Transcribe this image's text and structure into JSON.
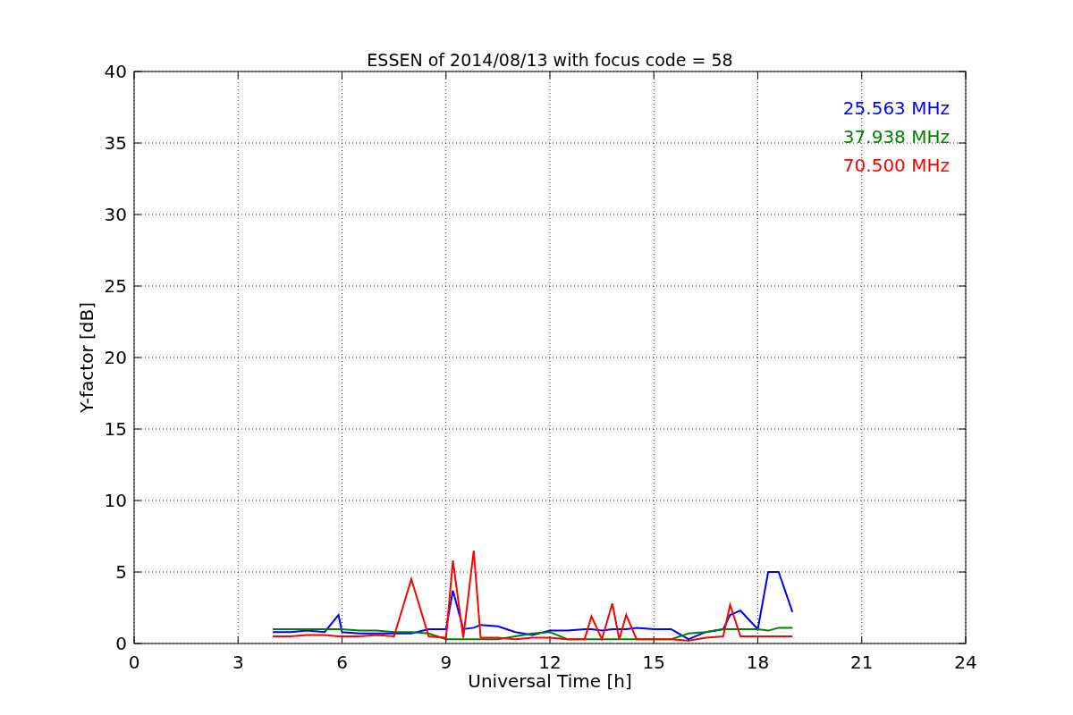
{
  "chart_data": {
    "type": "line",
    "title": "ESSEN of 2014/08/13 with focus code = 58",
    "xlabel": "Universal Time [h]",
    "ylabel": "Y-factor [dB]",
    "x": [
      4,
      4.5,
      5,
      5.5,
      5.9,
      6,
      6.5,
      7,
      7.5,
      8,
      8.5,
      9,
      9.2,
      9.5,
      9.8,
      10,
      10.5,
      11,
      11.5,
      12,
      12.5,
      13,
      13.2,
      13.5,
      13.8,
      14,
      14.2,
      14.5,
      15,
      15.5,
      16,
      16.5,
      17,
      17.2,
      17.5,
      18,
      18.3,
      18.6,
      19
    ],
    "grid": true,
    "xlim": [
      0,
      24
    ],
    "ylim": [
      0,
      40
    ],
    "xticks": [
      0,
      3,
      6,
      9,
      12,
      15,
      18,
      21,
      24
    ],
    "yticks": [
      0,
      5,
      10,
      15,
      20,
      25,
      30,
      35,
      40
    ],
    "series": [
      {
        "name": "25.563 MHz",
        "color": "#0000ff",
        "values": [
          0.8,
          0.8,
          0.9,
          0.8,
          2.0,
          0.8,
          0.7,
          0.7,
          0.7,
          0.7,
          1.0,
          1.0,
          3.7,
          1.0,
          1.1,
          1.3,
          1.2,
          0.8,
          0.6,
          0.9,
          0.9,
          1.0,
          1.0,
          0.9,
          1.0,
          1.0,
          1.0,
          1.1,
          1.0,
          1.0,
          0.3,
          0.8,
          1.0,
          2.0,
          2.3,
          1.0,
          5.0,
          5.0,
          2.2
        ]
      },
      {
        "name": "37.938 MHz",
        "color": "#008000",
        "values": [
          1.0,
          1.0,
          1.0,
          1.0,
          1.0,
          1.0,
          0.9,
          0.9,
          0.8,
          0.8,
          0.7,
          0.3,
          0.3,
          0.3,
          0.3,
          0.3,
          0.3,
          0.5,
          0.7,
          0.8,
          0.3,
          0.3,
          0.3,
          0.3,
          0.3,
          0.3,
          0.3,
          0.3,
          0.3,
          0.3,
          0.7,
          0.8,
          1.0,
          1.0,
          1.0,
          1.0,
          0.9,
          1.1,
          1.1
        ]
      },
      {
        "name": "70.500 MHz",
        "color": "#ff0000",
        "values": [
          0.5,
          0.5,
          0.6,
          0.6,
          0.5,
          0.5,
          0.5,
          0.6,
          0.5,
          4.5,
          0.5,
          0.4,
          5.8,
          0.4,
          6.5,
          0.4,
          0.4,
          0.3,
          0.4,
          0.4,
          0.3,
          0.3,
          1.9,
          0.3,
          2.8,
          0.3,
          2.0,
          0.3,
          0.3,
          0.3,
          0.2,
          0.4,
          0.5,
          2.7,
          0.5,
          0.5,
          0.5,
          0.5,
          0.5
        ]
      }
    ]
  }
}
